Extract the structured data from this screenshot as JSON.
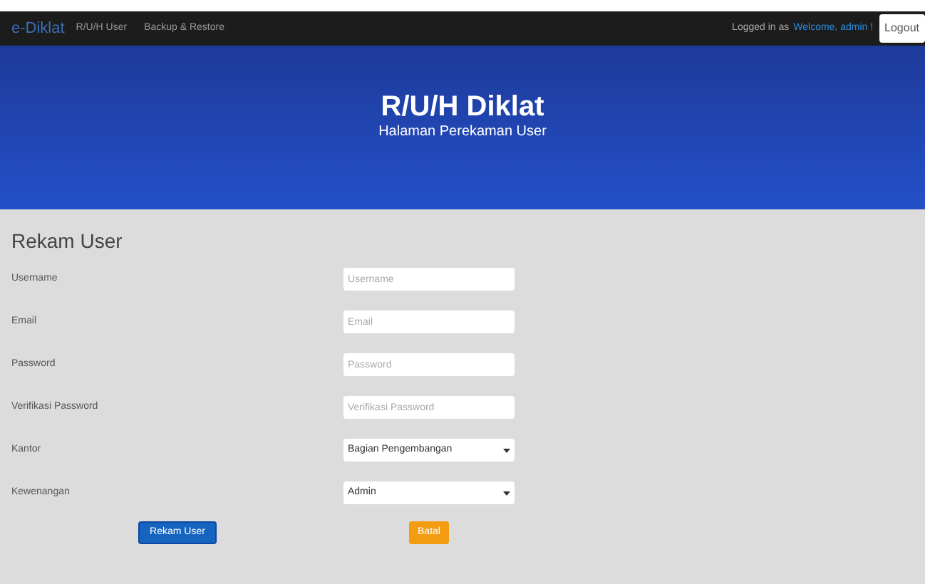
{
  "navbar": {
    "brand": "e-Diklat",
    "links": [
      {
        "label": "R/U/H User"
      },
      {
        "label": "Backup & Restore"
      }
    ],
    "logged_in_prefix": "Logged in as",
    "user_link": "Welcome, admin !",
    "logout": "Logout"
  },
  "banner": {
    "title": "R/U/H Diklat",
    "subtitle": "Halaman Perekaman User"
  },
  "form": {
    "title": "Rekam User",
    "fields": [
      {
        "kind": "input",
        "label": "Username",
        "placeholder": "Username"
      },
      {
        "kind": "input",
        "label": "Email",
        "placeholder": "Email"
      },
      {
        "kind": "input",
        "label": "Password",
        "placeholder": "Password"
      },
      {
        "kind": "input",
        "label": "Verifikasi Password",
        "placeholder": "Verifikasi Password"
      },
      {
        "kind": "select",
        "label": "Kantor",
        "value": "Bagian Pengembangan"
      },
      {
        "kind": "select",
        "label": "Kewenangan",
        "value": "Admin"
      }
    ],
    "submit": "Rekam User",
    "cancel": "Batal"
  }
}
